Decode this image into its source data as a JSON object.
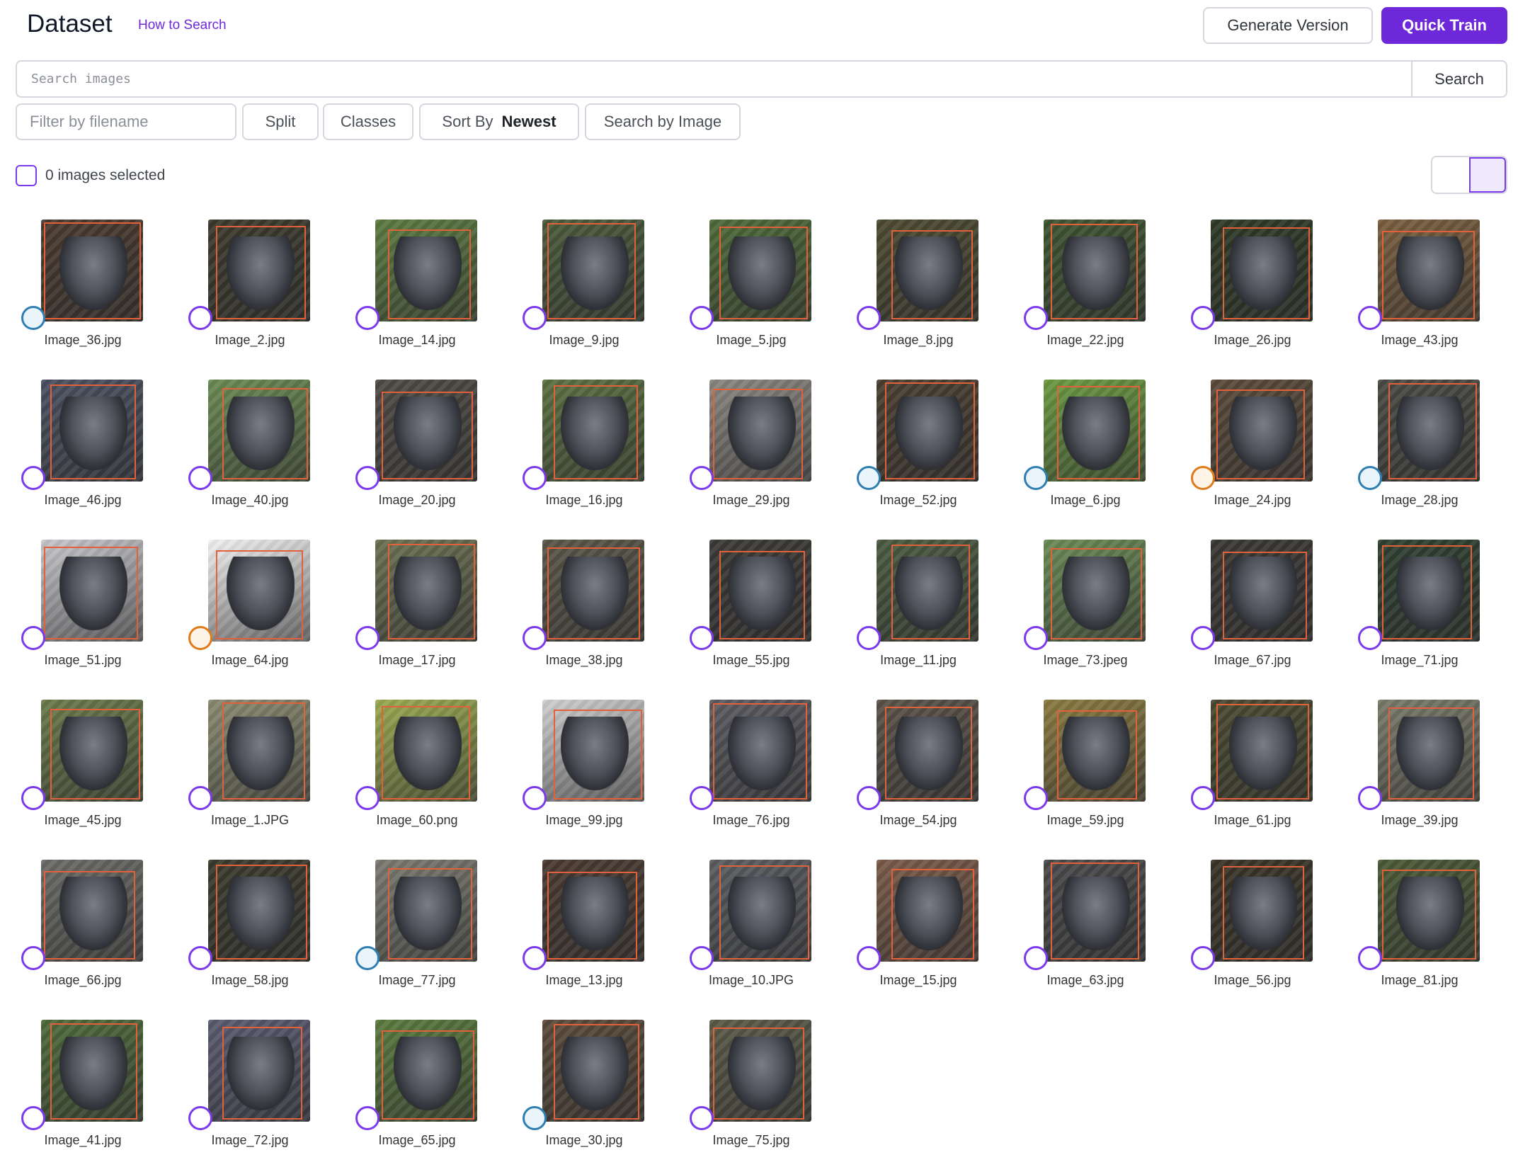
{
  "header": {
    "title": "Dataset",
    "how_to_search": "How to Search",
    "generate_version": "Generate Version",
    "quick_train": "Quick Train"
  },
  "search": {
    "placeholder": "Search images",
    "button": "Search"
  },
  "filters": {
    "filename_placeholder": "Filter by filename",
    "split": "Split",
    "classes": "Classes",
    "sort_by_label": "Sort By",
    "sort_by_value": "Newest",
    "search_by_image": "Search by Image"
  },
  "selection": {
    "label": "0 images selected"
  },
  "colors": {
    "accent": "#6d28d9",
    "split_train": "#7c3aed",
    "split_valid": "#2f7fb3",
    "split_test": "#e07b1a",
    "bbox": "#e0613a"
  },
  "images": [
    {
      "name": "Image_36.jpg",
      "split": "valid",
      "tone": "#4a3a2e"
    },
    {
      "name": "Image_2.jpg",
      "split": "train",
      "tone": "#3c3a2c"
    },
    {
      "name": "Image_14.jpg",
      "split": "train",
      "tone": "#5c7a40"
    },
    {
      "name": "Image_9.jpg",
      "split": "train",
      "tone": "#4a5a3a"
    },
    {
      "name": "Image_5.jpg",
      "split": "train",
      "tone": "#4e6a38"
    },
    {
      "name": "Image_8.jpg",
      "split": "train",
      "tone": "#4c4a30"
    },
    {
      "name": "Image_22.jpg",
      "split": "train",
      "tone": "#3e5430"
    },
    {
      "name": "Image_26.jpg",
      "split": "train",
      "tone": "#2e3a26"
    },
    {
      "name": "Image_43.jpg",
      "split": "train",
      "tone": "#7a5e3e"
    },
    {
      "name": "Image_46.jpg",
      "split": "train",
      "tone": "#4a5060"
    },
    {
      "name": "Image_40.jpg",
      "split": "train",
      "tone": "#6a8a52"
    },
    {
      "name": "Image_20.jpg",
      "split": "train",
      "tone": "#4e4a44"
    },
    {
      "name": "Image_16.jpg",
      "split": "train",
      "tone": "#5a7040"
    },
    {
      "name": "Image_29.jpg",
      "split": "train",
      "tone": "#8a8680"
    },
    {
      "name": "Image_52.jpg",
      "split": "valid",
      "tone": "#4a3e30"
    },
    {
      "name": "Image_6.jpg",
      "split": "valid",
      "tone": "#6a9a40"
    },
    {
      "name": "Image_24.jpg",
      "split": "test",
      "tone": "#5a4a3a"
    },
    {
      "name": "Image_28.jpg",
      "split": "valid",
      "tone": "#4a4a44"
    },
    {
      "name": "Image_51.jpg",
      "split": "train",
      "tone": "#c8c8cc"
    },
    {
      "name": "Image_64.jpg",
      "split": "test",
      "tone": "#f2f2f2"
    },
    {
      "name": "Image_17.jpg",
      "split": "train",
      "tone": "#6a7050"
    },
    {
      "name": "Image_38.jpg",
      "split": "train",
      "tone": "#5a5648"
    },
    {
      "name": "Image_55.jpg",
      "split": "train",
      "tone": "#3c3a36"
    },
    {
      "name": "Image_11.jpg",
      "split": "train",
      "tone": "#4a5a40"
    },
    {
      "name": "Image_73.jpeg",
      "split": "train",
      "tone": "#6a8a54"
    },
    {
      "name": "Image_67.jpg",
      "split": "train",
      "tone": "#3a3834"
    },
    {
      "name": "Image_71.jpg",
      "split": "train",
      "tone": "#2e4030"
    },
    {
      "name": "Image_45.jpg",
      "split": "train",
      "tone": "#6a7a4a"
    },
    {
      "name": "Image_1.JPG",
      "split": "train",
      "tone": "#8a8a70"
    },
    {
      "name": "Image_60.png",
      "split": "train",
      "tone": "#9aaa50"
    },
    {
      "name": "Image_99.jpg",
      "split": "train",
      "tone": "#d0d0d0"
    },
    {
      "name": "Image_76.jpg",
      "split": "train",
      "tone": "#5a5a60"
    },
    {
      "name": "Image_54.jpg",
      "split": "train",
      "tone": "#5a5248"
    },
    {
      "name": "Image_59.jpg",
      "split": "train",
      "tone": "#8a7a40"
    },
    {
      "name": "Image_61.jpg",
      "split": "train",
      "tone": "#4a4a30"
    },
    {
      "name": "Image_39.jpg",
      "split": "train",
      "tone": "#7a7a6a"
    },
    {
      "name": "Image_66.jpg",
      "split": "train",
      "tone": "#6a6a66"
    },
    {
      "name": "Image_58.jpg",
      "split": "train",
      "tone": "#3a3a2c"
    },
    {
      "name": "Image_77.jpg",
      "split": "valid",
      "tone": "#7a7a70"
    },
    {
      "name": "Image_13.jpg",
      "split": "train",
      "tone": "#4a3a30"
    },
    {
      "name": "Image_10.JPG",
      "split": "train",
      "tone": "#5a5c60"
    },
    {
      "name": "Image_15.jpg",
      "split": "train",
      "tone": "#7a5a48"
    },
    {
      "name": "Image_63.jpg",
      "split": "train",
      "tone": "#4a4a4c"
    },
    {
      "name": "Image_56.jpg",
      "split": "train",
      "tone": "#3a3428"
    },
    {
      "name": "Image_81.jpg",
      "split": "train",
      "tone": "#4a5a36"
    },
    {
      "name": "Image_41.jpg",
      "split": "train",
      "tone": "#4e6a3a"
    },
    {
      "name": "Image_72.jpg",
      "split": "train",
      "tone": "#5a5a70"
    },
    {
      "name": "Image_65.jpg",
      "split": "train",
      "tone": "#5a7a3e"
    },
    {
      "name": "Image_30.jpg",
      "split": "valid",
      "tone": "#5a4a3a"
    },
    {
      "name": "Image_75.jpg",
      "split": "train",
      "tone": "#5a5a48"
    }
  ]
}
